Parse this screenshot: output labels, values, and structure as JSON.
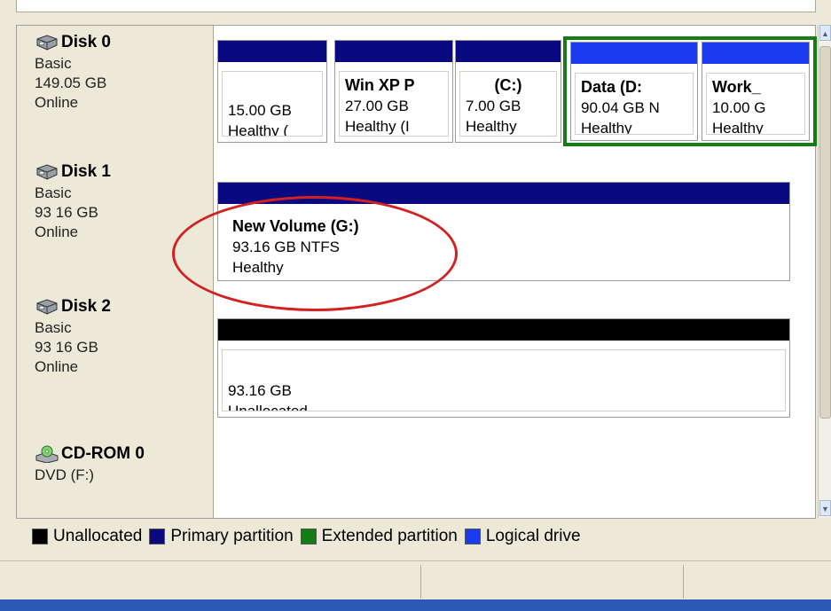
{
  "colors": {
    "unallocated": "#000000",
    "primary": "#0a0a80",
    "extended": "#137c15",
    "logical": "#1a3bf0",
    "annotation": "#d42020"
  },
  "disks": [
    {
      "title": "Disk 0",
      "icon": "disk-drive-icon",
      "type": "Basic",
      "size": "149.05 GB",
      "status": "Online",
      "partitions": [
        {
          "name": "",
          "size": "15.00 GB",
          "health": "Healthy (",
          "kind": "primary"
        },
        {
          "name": "Win XP P",
          "size": "27.00 GB",
          "health": "Healthy (I",
          "kind": "primary"
        },
        {
          "name": "(C:)",
          "size": "7.00 GB",
          "health": "Healthy",
          "kind": "primary"
        },
        {
          "name": "Data  (D:",
          "size": "90.04 GB N",
          "health": "Healthy",
          "kind": "logical"
        },
        {
          "name": "Work_",
          "size": "10.00 G",
          "health": "Healthy",
          "kind": "logical"
        }
      ]
    },
    {
      "title": "Disk 1",
      "icon": "disk-drive-icon",
      "type": "Basic",
      "size": "93 16 GB",
      "status": "Online",
      "partitions": [
        {
          "name": "New Volume  (G:)",
          "size": "93.16 GB NTFS",
          "health": "Healthy",
          "kind": "primary"
        }
      ]
    },
    {
      "title": "Disk 2",
      "icon": "disk-drive-icon",
      "type": "Basic",
      "size": "93 16 GB",
      "status": "Online",
      "partitions": [
        {
          "name": "",
          "size": "93.16 GB",
          "health": "Unallocated",
          "kind": "unallocated"
        }
      ]
    },
    {
      "title": "CD-ROM 0",
      "icon": "cd-rom-icon",
      "type": "DVD (F:)"
    }
  ],
  "legend": [
    {
      "label": "Unallocated",
      "color": "#000000"
    },
    {
      "label": "Primary partition",
      "color": "#0a0a80"
    },
    {
      "label": "Extended partition",
      "color": "#137c15"
    },
    {
      "label": "Logical drive",
      "color": "#1a3bf0"
    }
  ]
}
